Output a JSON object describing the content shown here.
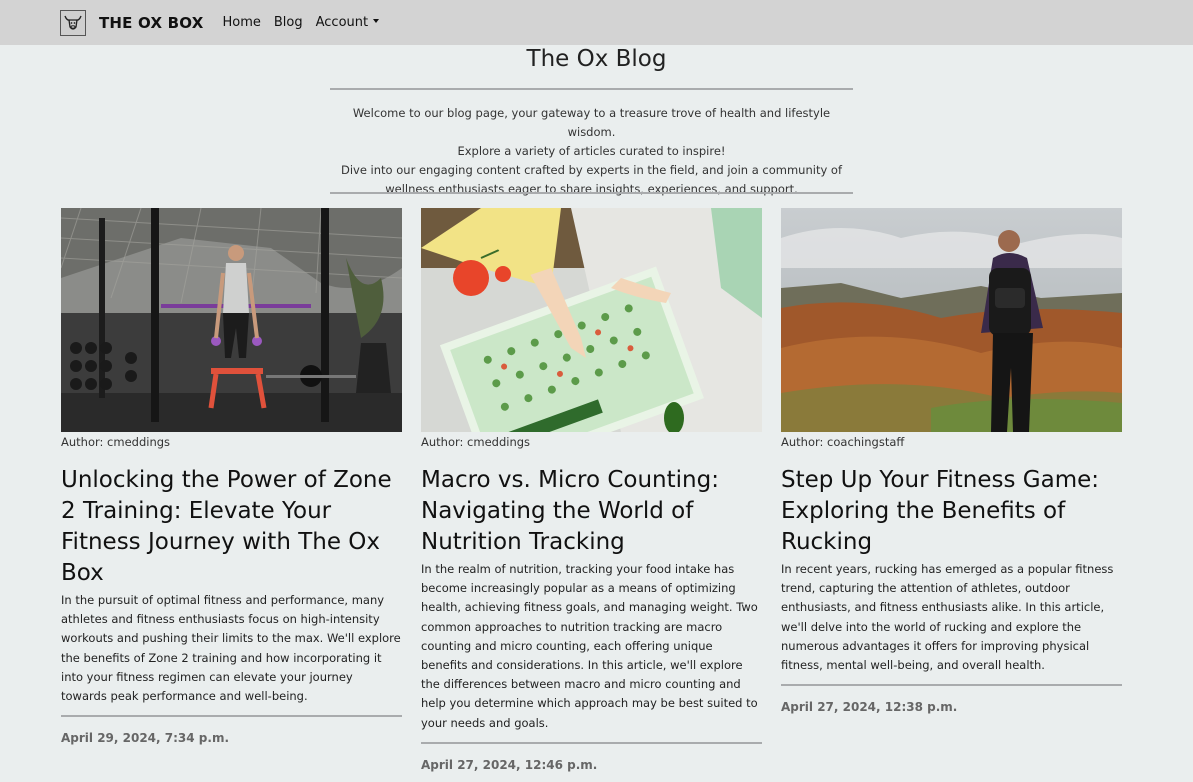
{
  "navbar": {
    "brand": "THE OX BOX",
    "links": [
      "Home",
      "Blog"
    ],
    "account": "Account"
  },
  "header": {
    "title": "The Ox Blog",
    "intro_lines": [
      "Welcome to our blog page, your gateway to a treasure trove of health and lifestyle wisdom.",
      "Explore a variety of articles curated to inspire!",
      "Dive into our engaging content crafted by experts in the field, and join a community of",
      "wellness enthusiasts eager to share insights, experiences, and support."
    ]
  },
  "posts": [
    {
      "author": "Author: cmeddings",
      "title": "Unlocking the Power of Zone 2 Training: Elevate Your Fitness Journey with The Ox Box",
      "excerpt": "In the pursuit of optimal fitness and performance, many athletes and fitness enthusiasts focus on high-intensity workouts and pushing their limits to the max. We'll explore the benefits of Zone 2 training and how incorporating it into your fitness regimen can elevate your journey towards peak performance and well-being.",
      "date": "April 29, 2024, 7:34 p.m."
    },
    {
      "author": "Author: cmeddings",
      "title": "Macro vs. Micro Counting: Navigating the World of Nutrition Tracking",
      "excerpt": "In the realm of nutrition, tracking your food intake has become increasingly popular as a means of optimizing health, achieving fitness goals, and managing weight. Two common approaches to nutrition tracking are macro counting and micro counting, each offering unique benefits and considerations. In this article, we'll explore the differences between macro and micro counting and help you determine which approach may be best suited to your needs and goals.",
      "date": "April 27, 2024, 12:46 p.m."
    },
    {
      "author": "Author: coachingstaff",
      "title": "Step Up Your Fitness Game: Exploring the Benefits of Rucking",
      "excerpt": "In recent years, rucking has emerged as a popular fitness trend, capturing the attention of athletes, outdoor enthusiasts, and fitness enthusiasts alike. In this article, we'll delve into the world of rucking and explore the numerous advantages it offers for improving physical fitness, mental well-being, and overall health.",
      "date": "April 27, 2024, 12:38 p.m."
    }
  ]
}
